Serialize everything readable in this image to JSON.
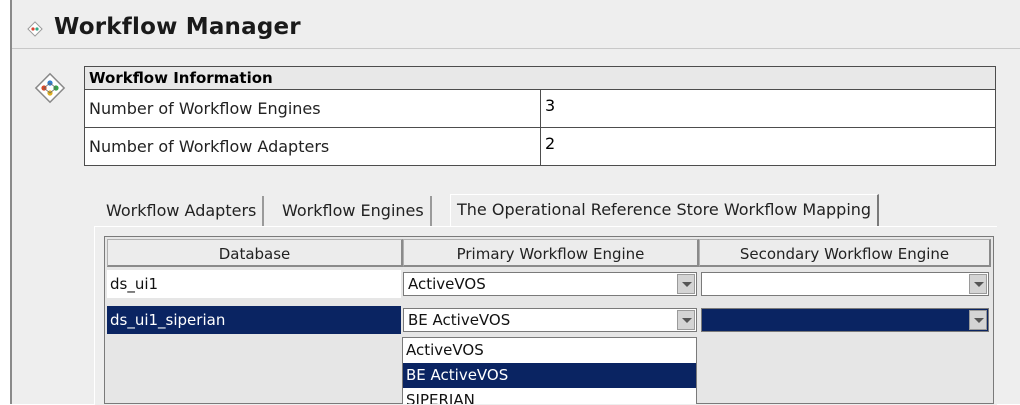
{
  "app": {
    "title": "Workflow Manager",
    "icon": "workflow-diamond-icon"
  },
  "info": {
    "header": "Workflow Information",
    "rows": [
      {
        "label": "Number of Workflow Engines",
        "value": "3"
      },
      {
        "label": "Number of Workflow Adapters",
        "value": "2"
      }
    ]
  },
  "tabs": [
    {
      "label": "Workflow Adapters",
      "active": false
    },
    {
      "label": "Workflow Engines",
      "active": false
    },
    {
      "label": "The Operational Reference Store Workflow Mapping",
      "active": true
    }
  ],
  "grid": {
    "columns": [
      "Database",
      "Primary Workflow Engine",
      "Secondary Workflow Engine"
    ],
    "rows": [
      {
        "database": "ds_ui1",
        "primary": "ActiveVOS",
        "secondary": "",
        "selected": false
      },
      {
        "database": "ds_ui1_siperian",
        "primary": "BE ActiveVOS",
        "secondary": "",
        "selected": true
      }
    ]
  },
  "dropdown": {
    "options": [
      "ActiveVOS",
      "BE ActiveVOS",
      "SIPERIAN"
    ],
    "highlighted": "BE ActiveVOS"
  },
  "colors": {
    "selection": "#0a2462",
    "panel_bg": "#eeeeee"
  }
}
